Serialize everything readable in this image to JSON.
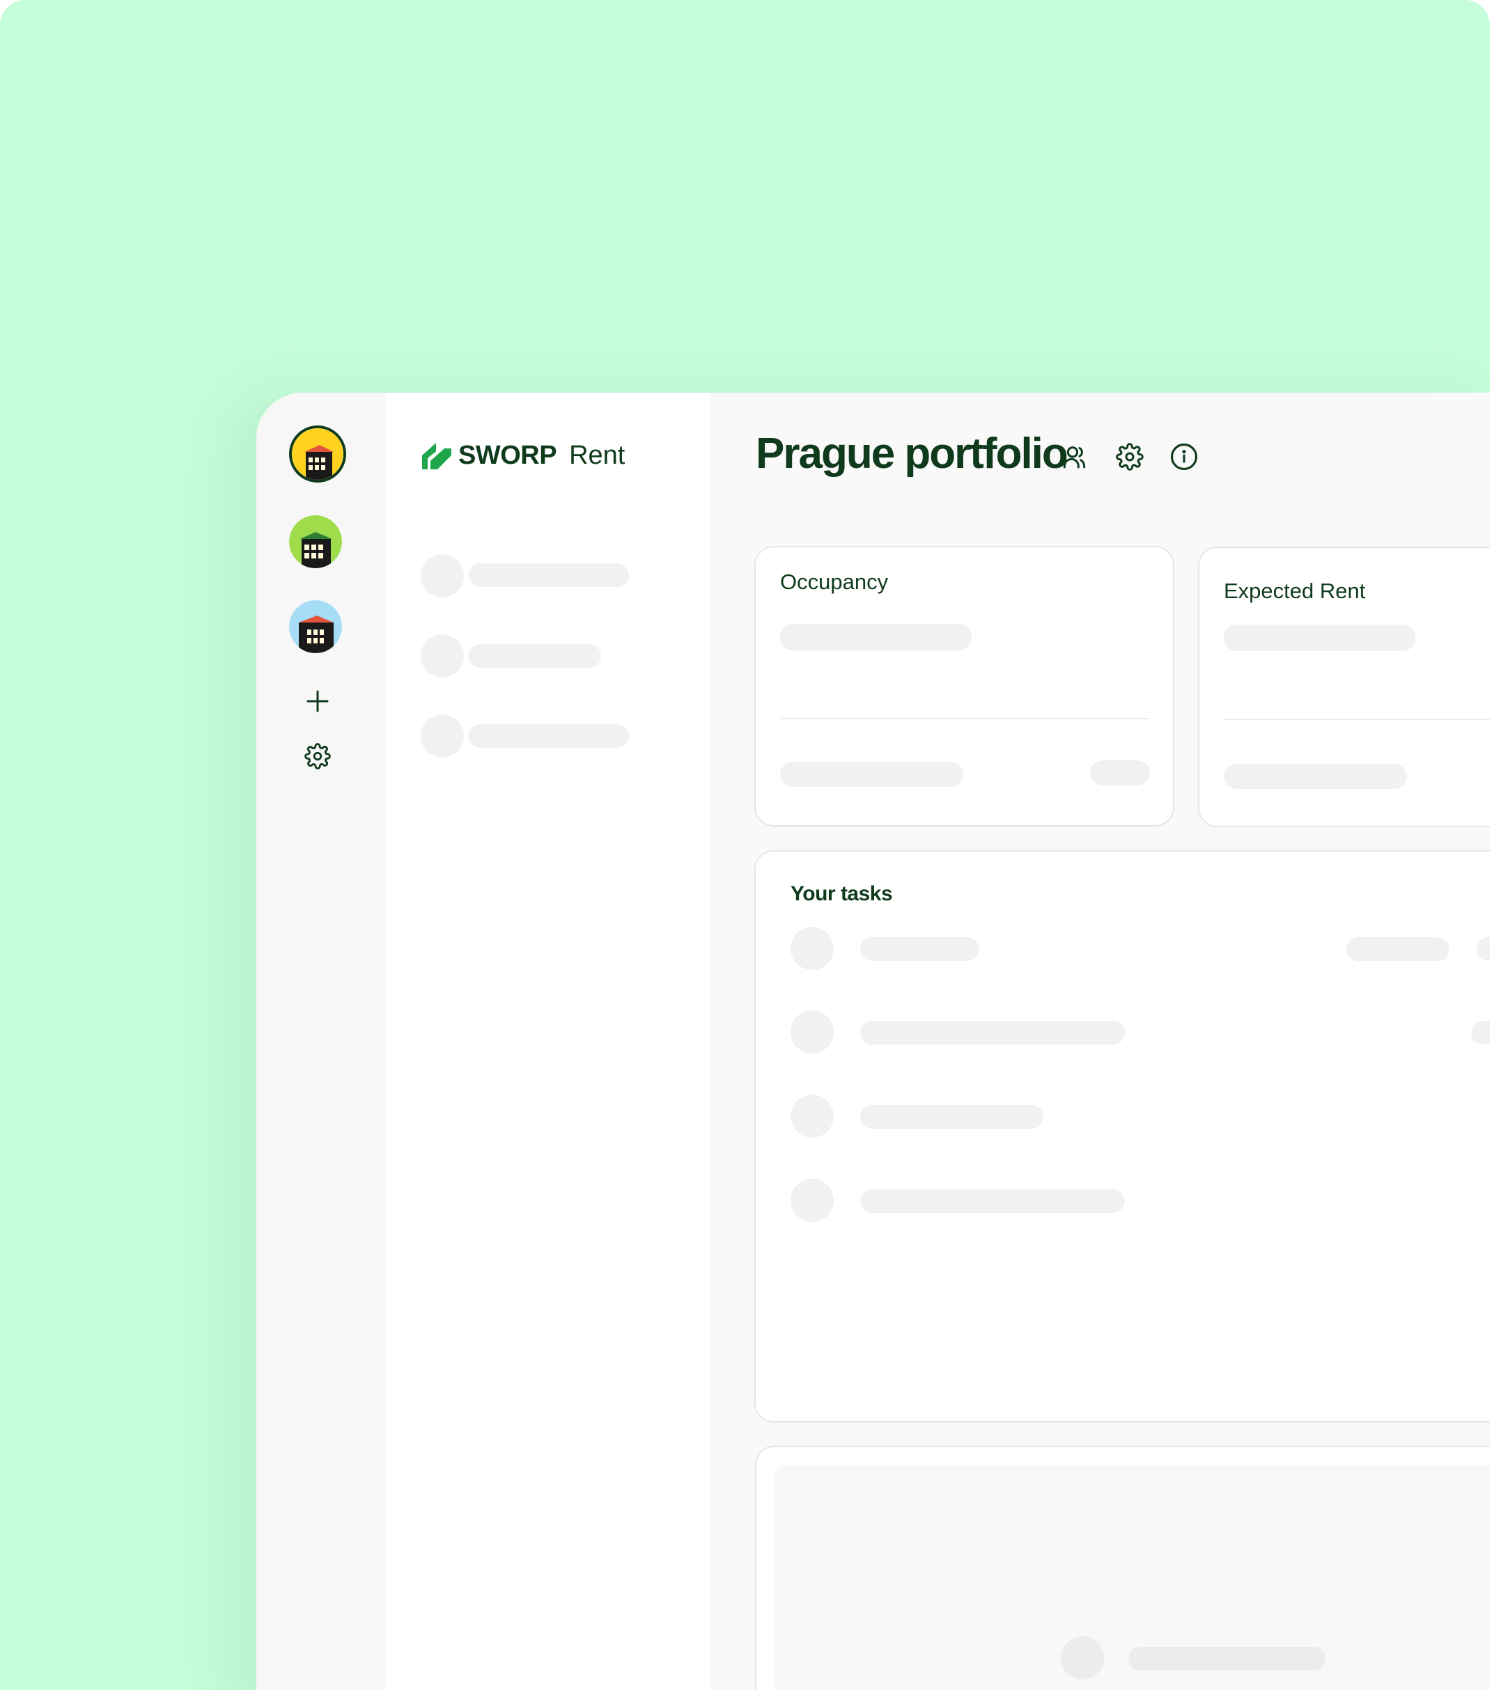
{
  "brand": {
    "name": "SWORP",
    "product": "Rent",
    "color": "#0f3a1c",
    "accent": "#1fa64a",
    "background": "#c6fdda"
  },
  "rail": {
    "portfolios": [
      {
        "name": "portfolio-avatar-yellow",
        "bg": "#ffd21f",
        "active": true
      },
      {
        "name": "portfolio-avatar-green",
        "bg": "#9fdc4c",
        "active": false
      },
      {
        "name": "portfolio-avatar-blue",
        "bg": "#a6dcf5",
        "active": false
      }
    ],
    "icons": [
      "plus-icon",
      "gear-icon"
    ]
  },
  "header": {
    "title": "Prague portfolio",
    "icons": [
      "users-icon",
      "gear-icon",
      "info-icon"
    ]
  },
  "cards": {
    "occupancy_label": "Occupancy",
    "expected_rent_label": "Expected Rent"
  },
  "tasks": {
    "title": "Your tasks"
  }
}
